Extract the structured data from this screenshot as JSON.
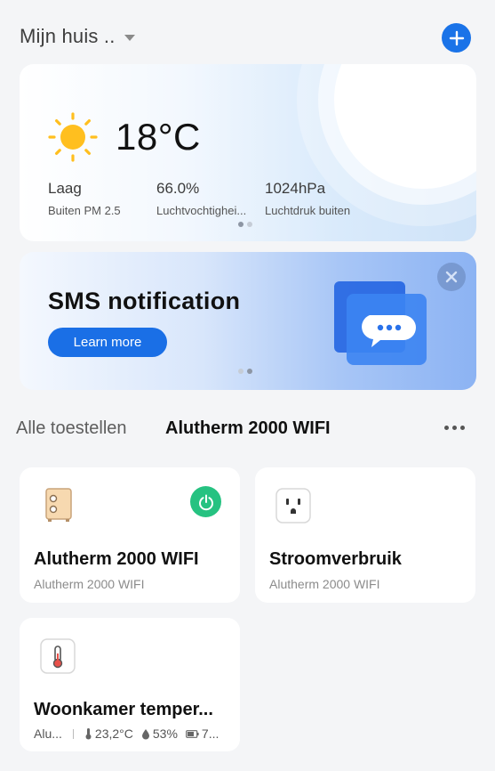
{
  "header": {
    "home_title": "Mijn huis ..",
    "add_icon": "plus-icon"
  },
  "weather": {
    "icon": "sun-icon",
    "temperature": "18°C",
    "stats": [
      {
        "value": "Laag",
        "label": "Buiten PM 2.5"
      },
      {
        "value": "66.0%",
        "label": "Luchtvochtighei..."
      },
      {
        "value": "1024hPa",
        "label": "Luchtdruk buiten"
      }
    ],
    "page_indicator": {
      "count": 2,
      "active": 1
    }
  },
  "promo": {
    "title": "SMS notification",
    "button_label": "Learn more",
    "icon": "chat-bubble-icon",
    "page_indicator": {
      "count": 2,
      "active": 2
    }
  },
  "tabs": {
    "items": [
      {
        "label": "Alle toestellen",
        "selected": false
      },
      {
        "label": "Alutherm 2000 WIFI",
        "selected": true
      }
    ],
    "more_icon": "more-horizontal-icon"
  },
  "devices": [
    {
      "name": "Alutherm 2000 WIFI",
      "subtitle": "Alutherm 2000 WIFI",
      "icon": "heater-icon",
      "power": true
    },
    {
      "name": "Stroomverbruik",
      "subtitle": "Alutherm 2000 WIFI",
      "icon": "wall-socket-icon",
      "power": false
    },
    {
      "name": "Woonkamer temper...",
      "subtitle": "Alu...",
      "icon": "thermometer-icon",
      "readings": {
        "temperature": "23,2°C",
        "humidity": "53%",
        "battery": "7..."
      }
    }
  ],
  "colors": {
    "accent": "#1a73e8",
    "power_on": "#26c281",
    "background": "#f4f5f7"
  }
}
